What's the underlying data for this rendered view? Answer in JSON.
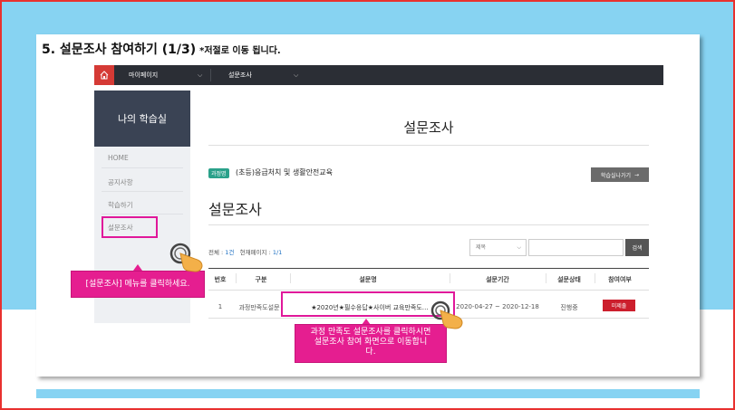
{
  "heading": {
    "title": "5.  설문조사 참여하기 (1/3)",
    "note": "*저절로 이동 됩니다."
  },
  "topnav": {
    "items": [
      "마이페이지",
      "설문조사"
    ]
  },
  "sidebar": {
    "title": "나의 학습실",
    "items": [
      "HOME",
      "공지사항",
      "학습하기",
      "설문조사"
    ]
  },
  "main": {
    "page_title": "설문조사",
    "course_badge": "과정명",
    "course_name": "(초등)응급처치 및 생활안전교육",
    "back_button": "학습실나가기",
    "section_title": "설문조사",
    "count_total_label": "전체 : ",
    "count_total": "1건",
    "count_page_label": "현재페이지 : ",
    "count_page": "1/1",
    "search_select": "제목",
    "search_input": "",
    "search_button": "검색",
    "table": {
      "headers": [
        "번호",
        "구분",
        "설문명",
        "설문기간",
        "설문상태",
        "참여여부"
      ],
      "rows": [
        [
          "1",
          "과정만족도설문",
          "★2020년★필수응답★사이버 교육만족도…",
          "2020-04-27 ~ 2020-12-18",
          "진행중",
          "미제출"
        ]
      ]
    }
  },
  "callouts": {
    "sidebar": "[설문조사] 메뉴를 클릭하세요.",
    "table_line1": "과정 만족도 설문조사를 클릭하시면",
    "table_line2": "설문조사 참여  화면으로 이동합니",
    "table_line3": "다."
  },
  "colors": {
    "accent": "#e51e90",
    "sky": "#87d3f2",
    "nav": "#2b2e35",
    "status": "#cc1f2d",
    "badge": "#2aa18a"
  }
}
